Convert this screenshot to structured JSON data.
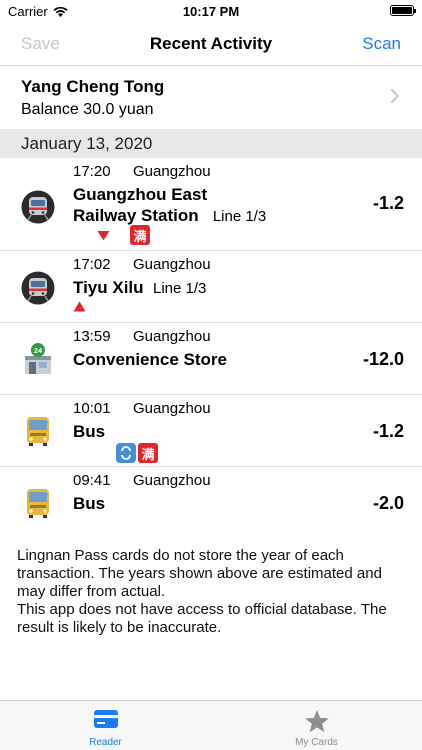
{
  "status_bar": {
    "carrier": "Carrier",
    "time": "10:17 PM"
  },
  "nav": {
    "save_label": "Save",
    "title": "Recent Activity",
    "scan_label": "Scan"
  },
  "card": {
    "name": "Yang Cheng Tong",
    "balance": "Balance 30.0 yuan"
  },
  "section": {
    "date": "January 13, 2020"
  },
  "transactions": [
    {
      "time": "17:20",
      "city": "Guangzhou",
      "place_line1": "Guangzhou East",
      "place_line2": "Railway Station",
      "line": "Line 1/3",
      "amount": "-1.2",
      "icon": "metro-train-icon",
      "flags": [
        "exit-arrow-down-icon",
        "full-fare-badge"
      ]
    },
    {
      "time": "17:02",
      "city": "Guangzhou",
      "place": "Tiyu Xilu",
      "line": "Line 1/3",
      "amount": "",
      "icon": "metro-train-icon",
      "flags": [
        "entry-arrow-up-icon"
      ]
    },
    {
      "time": "13:59",
      "city": "Guangzhou",
      "place": "Convenience Store",
      "amount": "-12.0",
      "icon": "convenience-store-icon",
      "flags": []
    },
    {
      "time": "10:01",
      "city": "Guangzhou",
      "place": "Bus",
      "amount": "-1.2",
      "icon": "bus-icon",
      "flags": [
        "transfer-icon",
        "full-fare-badge"
      ]
    },
    {
      "time": "09:41",
      "city": "Guangzhou",
      "place": "Bus",
      "amount": "-2.0",
      "icon": "bus-icon",
      "flags": []
    }
  ],
  "badges": {
    "full_fare": "满"
  },
  "store_sign": "24",
  "note": {
    "line1": "Lingnan Pass cards do not store the year of each transaction. The years shown above are estimated and may differ from actual.",
    "line2": "This app does not have access to official database. The result is likely to be inaccurate."
  },
  "tabs": [
    {
      "label": "Reader",
      "icon": "card-reader-icon",
      "active": true
    },
    {
      "label": "My Cards",
      "icon": "star-icon",
      "active": false
    }
  ],
  "colors": {
    "accent": "#1a7cf5",
    "badge_red": "#e0262d",
    "section_bg": "#e9e9ea",
    "disabled": "#c6c6c8"
  }
}
